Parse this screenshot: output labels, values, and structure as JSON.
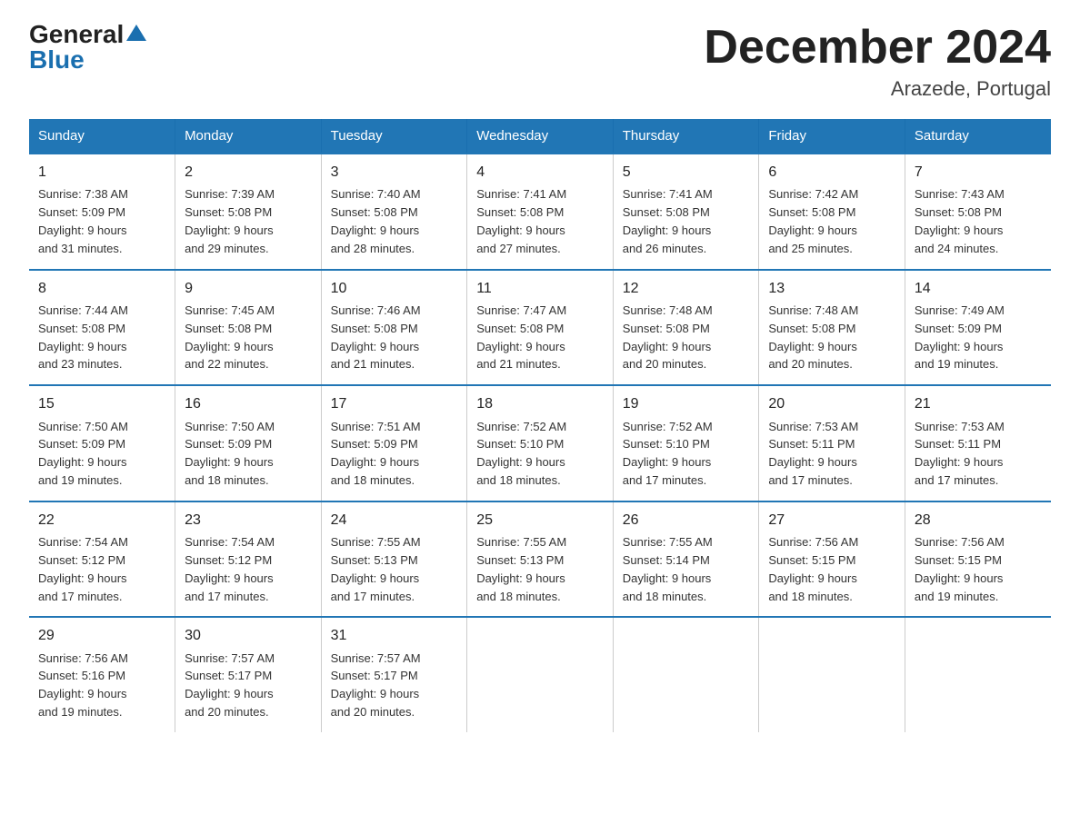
{
  "logo": {
    "general": "General",
    "blue": "Blue",
    "triangle": "▲"
  },
  "title": "December 2024",
  "subtitle": "Arazede, Portugal",
  "days_of_week": [
    "Sunday",
    "Monday",
    "Tuesday",
    "Wednesday",
    "Thursday",
    "Friday",
    "Saturday"
  ],
  "weeks": [
    [
      {
        "num": "1",
        "sunrise": "7:38 AM",
        "sunset": "5:09 PM",
        "daylight": "9 hours and 31 minutes."
      },
      {
        "num": "2",
        "sunrise": "7:39 AM",
        "sunset": "5:08 PM",
        "daylight": "9 hours and 29 minutes."
      },
      {
        "num": "3",
        "sunrise": "7:40 AM",
        "sunset": "5:08 PM",
        "daylight": "9 hours and 28 minutes."
      },
      {
        "num": "4",
        "sunrise": "7:41 AM",
        "sunset": "5:08 PM",
        "daylight": "9 hours and 27 minutes."
      },
      {
        "num": "5",
        "sunrise": "7:41 AM",
        "sunset": "5:08 PM",
        "daylight": "9 hours and 26 minutes."
      },
      {
        "num": "6",
        "sunrise": "7:42 AM",
        "sunset": "5:08 PM",
        "daylight": "9 hours and 25 minutes."
      },
      {
        "num": "7",
        "sunrise": "7:43 AM",
        "sunset": "5:08 PM",
        "daylight": "9 hours and 24 minutes."
      }
    ],
    [
      {
        "num": "8",
        "sunrise": "7:44 AM",
        "sunset": "5:08 PM",
        "daylight": "9 hours and 23 minutes."
      },
      {
        "num": "9",
        "sunrise": "7:45 AM",
        "sunset": "5:08 PM",
        "daylight": "9 hours and 22 minutes."
      },
      {
        "num": "10",
        "sunrise": "7:46 AM",
        "sunset": "5:08 PM",
        "daylight": "9 hours and 21 minutes."
      },
      {
        "num": "11",
        "sunrise": "7:47 AM",
        "sunset": "5:08 PM",
        "daylight": "9 hours and 21 minutes."
      },
      {
        "num": "12",
        "sunrise": "7:48 AM",
        "sunset": "5:08 PM",
        "daylight": "9 hours and 20 minutes."
      },
      {
        "num": "13",
        "sunrise": "7:48 AM",
        "sunset": "5:08 PM",
        "daylight": "9 hours and 20 minutes."
      },
      {
        "num": "14",
        "sunrise": "7:49 AM",
        "sunset": "5:09 PM",
        "daylight": "9 hours and 19 minutes."
      }
    ],
    [
      {
        "num": "15",
        "sunrise": "7:50 AM",
        "sunset": "5:09 PM",
        "daylight": "9 hours and 19 minutes."
      },
      {
        "num": "16",
        "sunrise": "7:50 AM",
        "sunset": "5:09 PM",
        "daylight": "9 hours and 18 minutes."
      },
      {
        "num": "17",
        "sunrise": "7:51 AM",
        "sunset": "5:09 PM",
        "daylight": "9 hours and 18 minutes."
      },
      {
        "num": "18",
        "sunrise": "7:52 AM",
        "sunset": "5:10 PM",
        "daylight": "9 hours and 18 minutes."
      },
      {
        "num": "19",
        "sunrise": "7:52 AM",
        "sunset": "5:10 PM",
        "daylight": "9 hours and 17 minutes."
      },
      {
        "num": "20",
        "sunrise": "7:53 AM",
        "sunset": "5:11 PM",
        "daylight": "9 hours and 17 minutes."
      },
      {
        "num": "21",
        "sunrise": "7:53 AM",
        "sunset": "5:11 PM",
        "daylight": "9 hours and 17 minutes."
      }
    ],
    [
      {
        "num": "22",
        "sunrise": "7:54 AM",
        "sunset": "5:12 PM",
        "daylight": "9 hours and 17 minutes."
      },
      {
        "num": "23",
        "sunrise": "7:54 AM",
        "sunset": "5:12 PM",
        "daylight": "9 hours and 17 minutes."
      },
      {
        "num": "24",
        "sunrise": "7:55 AM",
        "sunset": "5:13 PM",
        "daylight": "9 hours and 17 minutes."
      },
      {
        "num": "25",
        "sunrise": "7:55 AM",
        "sunset": "5:13 PM",
        "daylight": "9 hours and 18 minutes."
      },
      {
        "num": "26",
        "sunrise": "7:55 AM",
        "sunset": "5:14 PM",
        "daylight": "9 hours and 18 minutes."
      },
      {
        "num": "27",
        "sunrise": "7:56 AM",
        "sunset": "5:15 PM",
        "daylight": "9 hours and 18 minutes."
      },
      {
        "num": "28",
        "sunrise": "7:56 AM",
        "sunset": "5:15 PM",
        "daylight": "9 hours and 19 minutes."
      }
    ],
    [
      {
        "num": "29",
        "sunrise": "7:56 AM",
        "sunset": "5:16 PM",
        "daylight": "9 hours and 19 minutes."
      },
      {
        "num": "30",
        "sunrise": "7:57 AM",
        "sunset": "5:17 PM",
        "daylight": "9 hours and 20 minutes."
      },
      {
        "num": "31",
        "sunrise": "7:57 AM",
        "sunset": "5:17 PM",
        "daylight": "9 hours and 20 minutes."
      },
      null,
      null,
      null,
      null
    ]
  ],
  "labels": {
    "sunrise": "Sunrise:",
    "sunset": "Sunset:",
    "daylight": "Daylight:"
  }
}
